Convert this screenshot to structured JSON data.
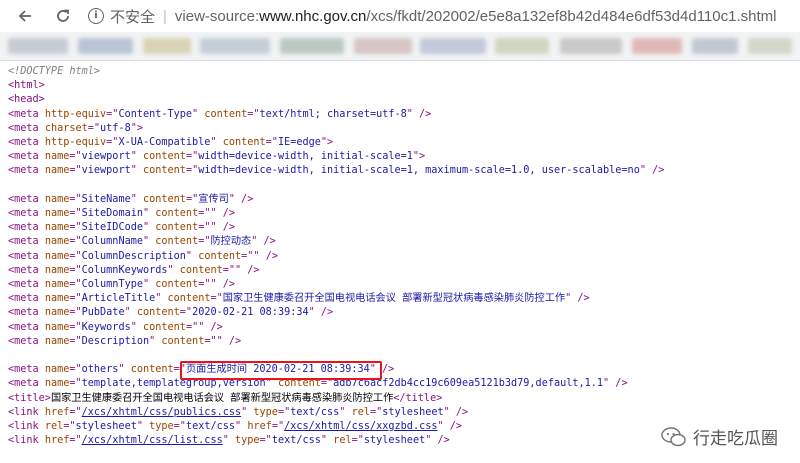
{
  "browser": {
    "security_label": "不安全",
    "url_scheme": "view-source:",
    "url_host": "www.nhc.gov.cn",
    "url_path": "/xcs/fkdt/202002/e5e8a132ef8b42d484e6df53d4d110c1.shtml"
  },
  "source_lines": [
    {
      "doctype": "<!DOCTYPE html>"
    },
    {
      "tag": "html"
    },
    {
      "tag": "head"
    },
    {
      "tag": "meta",
      "attrs": [
        [
          "http-equiv",
          "Content-Type"
        ],
        [
          "content",
          "text/html; charset=utf-8"
        ]
      ],
      "self_close": true
    },
    {
      "tag": "meta",
      "attrs": [
        [
          "charset",
          "utf-8"
        ]
      ],
      "self_close": false
    },
    {
      "tag": "meta",
      "attrs": [
        [
          "http-equiv",
          "X-UA-Compatible"
        ],
        [
          "content",
          "IE=edge"
        ]
      ],
      "self_close": false
    },
    {
      "tag": "meta",
      "attrs": [
        [
          "name",
          "viewport"
        ],
        [
          "content",
          "width=device-width, initial-scale=1"
        ]
      ],
      "self_close": false
    },
    {
      "tag": "meta",
      "attrs": [
        [
          "name",
          "viewport"
        ],
        [
          "content",
          "width=device-width, initial-scale=1, maximum-scale=1.0, user-scalable=no"
        ]
      ],
      "self_close": true
    },
    {
      "blank": true
    },
    {
      "tag": "meta",
      "attrs": [
        [
          "name",
          "SiteName"
        ],
        [
          "content",
          "宣传司"
        ]
      ],
      "self_close": true
    },
    {
      "tag": "meta",
      "attrs": [
        [
          "name",
          "SiteDomain"
        ],
        [
          "content",
          ""
        ]
      ],
      "self_close": true
    },
    {
      "tag": "meta",
      "attrs": [
        [
          "name",
          "SiteIDCode"
        ],
        [
          "content",
          ""
        ]
      ],
      "self_close": true
    },
    {
      "tag": "meta",
      "attrs": [
        [
          "name",
          "ColumnName"
        ],
        [
          "content",
          "防控动态"
        ]
      ],
      "self_close": true
    },
    {
      "tag": "meta",
      "attrs": [
        [
          "name",
          "ColumnDescription"
        ],
        [
          "content",
          ""
        ]
      ],
      "self_close": true
    },
    {
      "tag": "meta",
      "attrs": [
        [
          "name",
          "ColumnKeywords"
        ],
        [
          "content",
          ""
        ]
      ],
      "self_close": true
    },
    {
      "tag": "meta",
      "attrs": [
        [
          "name",
          "ColumnType"
        ],
        [
          "content",
          ""
        ]
      ],
      "self_close": true
    },
    {
      "tag": "meta",
      "attrs": [
        [
          "name",
          "ArticleTitle"
        ],
        [
          "content",
          "国家卫生健康委召开全国电视电话会议 部署新型冠状病毒感染肺炎防控工作"
        ]
      ],
      "self_close": true
    },
    {
      "tag": "meta",
      "attrs": [
        [
          "name",
          "PubDate"
        ],
        [
          "content",
          "2020-02-21 08:39:34"
        ]
      ],
      "self_close": true
    },
    {
      "tag": "meta",
      "attrs": [
        [
          "name",
          "Keywords"
        ],
        [
          "content",
          ""
        ]
      ],
      "self_close": true
    },
    {
      "tag": "meta",
      "attrs": [
        [
          "name",
          "Description"
        ],
        [
          "content",
          ""
        ]
      ],
      "self_close": true
    },
    {
      "blank": true
    },
    {
      "tag": "meta",
      "attrs": [
        [
          "name",
          "others"
        ],
        [
          "content",
          "页面生成时间 2020-02-21 08:39:34"
        ]
      ],
      "self_close": true,
      "highlight": true
    },
    {
      "tag": "meta",
      "attrs": [
        [
          "name",
          "template,templategroup,version"
        ],
        [
          "content",
          "adb7c6acf2db4cc19c609ea5121b3d79,default,1.1"
        ]
      ],
      "self_close": true
    },
    {
      "title": "国家卫生健康委召开全国电视电话会议 部署新型冠状病毒感染肺炎防控工作"
    },
    {
      "tag": "link",
      "attrs": [
        [
          "href",
          "/xcs/xhtml/css/publics.css"
        ],
        [
          "type",
          "text/css"
        ],
        [
          "rel",
          "stylesheet"
        ]
      ],
      "link_attr": "href",
      "self_close": true
    },
    {
      "tag": "link",
      "attrs": [
        [
          "rel",
          "stylesheet"
        ],
        [
          "type",
          "text/css"
        ],
        [
          "href",
          "/xcs/xhtml/css/xxgzbd.css"
        ]
      ],
      "link_attr": "href",
      "self_close": true
    },
    {
      "tag": "link",
      "attrs": [
        [
          "href",
          "/xcs/xhtml/css/list.css"
        ],
        [
          "type",
          "text/css"
        ],
        [
          "rel",
          "stylesheet"
        ]
      ],
      "link_attr": "href",
      "self_close": true
    }
  ],
  "watermark": {
    "icon": "wechat-icon",
    "text": "行走吃瓜圈"
  },
  "colors": {
    "tag": "#881280",
    "attribute": "#994500",
    "value": "#1a1aa6",
    "highlight_box": "#e8131d"
  }
}
